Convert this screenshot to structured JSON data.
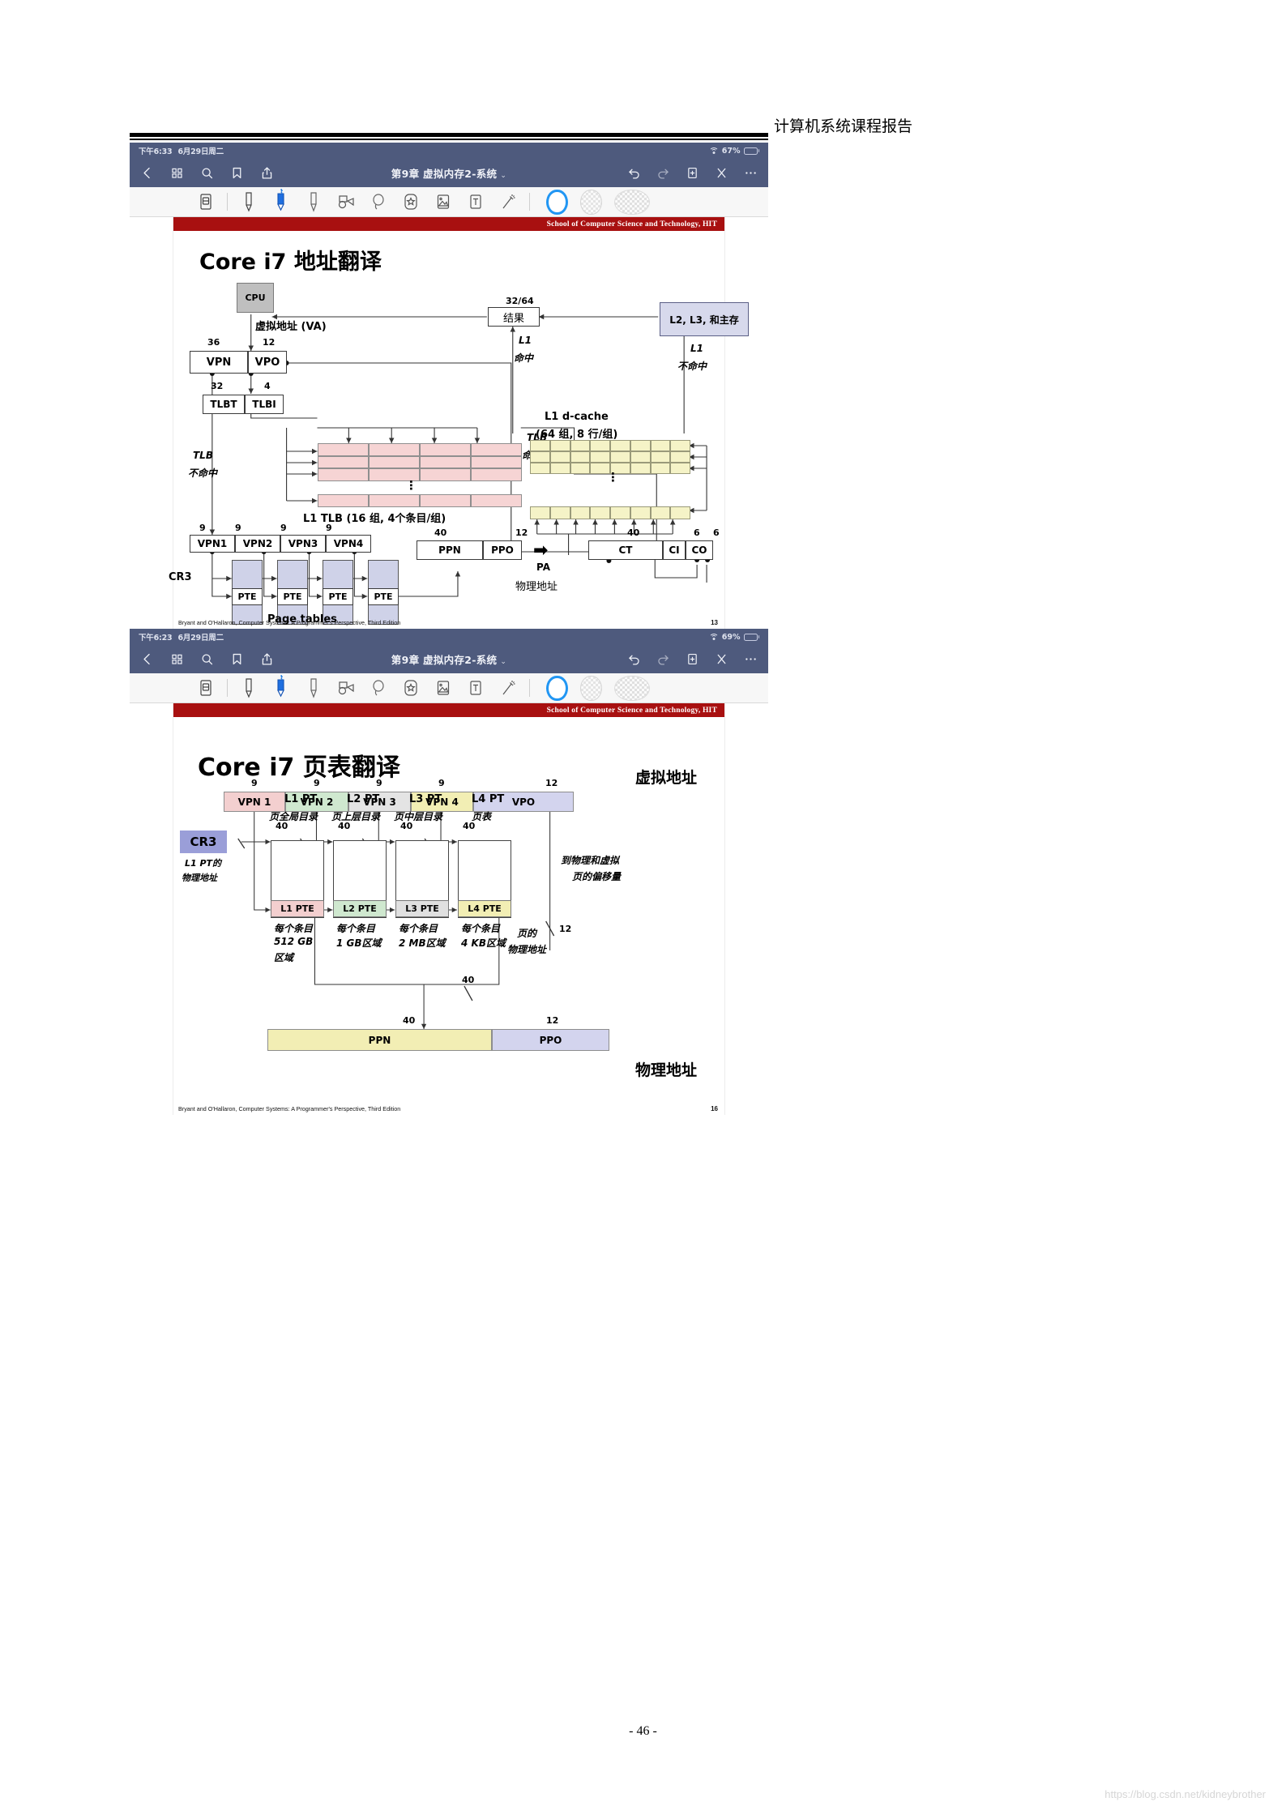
{
  "document": {
    "header_title": "计算机系统课程报告",
    "page_number": "- 46 -",
    "watermark": "https://blog.csdn.net/kidneybrother"
  },
  "screenshots": [
    {
      "status": {
        "time": "下午6:33",
        "date": "6月29日周二",
        "battery": "67%",
        "wifi_icon": "wifi-icon"
      },
      "nav": {
        "title": "第9章 虚拟内存2-系统",
        "chevron": "⌄",
        "left_icons": [
          "back-chevron-icon",
          "thumbnails-grid-icon",
          "search-icon",
          "bookmark-icon",
          "share-icon"
        ],
        "right_icons": [
          "undo-icon",
          "redo-icon",
          "add-page-icon",
          "close-icon",
          "more-icon"
        ]
      },
      "tools": {
        "items": [
          "eraser-icon",
          "pen-icon",
          "highlighter-icon",
          "pencil-icon",
          "shape-icon",
          "lasso-icon",
          "sticker-icon",
          "image-icon",
          "textbox-icon",
          "magic-wand-icon"
        ],
        "selected": "highlighter-icon",
        "swatches": [
          "active-color-swatch",
          "transparent-swatch-1",
          "transparent-swatch-2"
        ]
      },
      "slide": {
        "band": "School of Computer Science and Technology, HIT",
        "title": "Core i7 地址翻译",
        "footer": "Bryant and O'Hallaron, Computer Systems: A Programmer's Perspective, Third Edition",
        "number": "13",
        "nodes": {
          "cpu": "CPU",
          "va_label": "虚拟地址 (VA)",
          "result": "结果",
          "result_bits": "32/64",
          "mem": "L2, L3, 和主存",
          "l1_hit": [
            "L1",
            "命中"
          ],
          "l1_miss": [
            "L1",
            "不命中"
          ],
          "vpn": "VPN",
          "vpo": "VPO",
          "vpn_bits": "36",
          "vpo_bits": "12",
          "tlbt": "TLBT",
          "tlbi": "TLBI",
          "tlbt_bits": "32",
          "tlbi_bits": "4",
          "tlb_hit": [
            "TLB",
            "命中"
          ],
          "tlb_miss": [
            "TLB",
            "不命中"
          ],
          "tlb_caption": "L1 TLB (16 组, 4个条目/组)",
          "dcache_title": "L1 d-cache",
          "dcache_sub": "(64 组, 8 行/组)",
          "vpn_parts": [
            "VPN1",
            "VPN2",
            "VPN3",
            "VPN4"
          ],
          "vpn_part_bits": [
            "9",
            "9",
            "9",
            "9"
          ],
          "cr3": "CR3",
          "pte": [
            "PTE",
            "PTE",
            "PTE",
            "PTE"
          ],
          "page_tables": "Page tables",
          "ppn": "PPN",
          "ppo": "PPO",
          "ppn_bits": "40",
          "ppo_bits": "12",
          "pa": "PA",
          "pa_label": "物理地址",
          "ct": "CT",
          "ci": "CI",
          "co": "CO",
          "ct_bits": "40",
          "ci_bits": "6",
          "co_bits": "6"
        }
      }
    },
    {
      "status": {
        "time": "下午6:23",
        "date": "6月29日周二",
        "battery": "69%",
        "wifi_icon": "wifi-icon"
      },
      "nav": {
        "title": "第9章 虚拟内存2-系统",
        "chevron": "⌄",
        "left_icons": [
          "back-chevron-icon",
          "thumbnails-grid-icon",
          "search-icon",
          "bookmark-icon",
          "share-icon"
        ],
        "right_icons": [
          "undo-icon",
          "redo-icon",
          "add-page-icon",
          "close-icon",
          "more-icon"
        ]
      },
      "tools": {
        "items": [
          "eraser-icon",
          "pen-icon",
          "highlighter-icon",
          "pencil-icon",
          "shape-icon",
          "lasso-icon",
          "sticker-icon",
          "image-icon",
          "textbox-icon",
          "magic-wand-icon"
        ],
        "selected": "highlighter-icon",
        "swatches": [
          "active-color-swatch",
          "transparent-swatch-1",
          "transparent-swatch-2"
        ]
      },
      "slide": {
        "band": "School of Computer Science and Technology, HIT",
        "title": "Core i7 页表翻译",
        "footer": "Bryant and O'Hallaron, Computer Systems: A Programmer's Perspective, Third Edition",
        "number": "16",
        "nodes": {
          "va_label": "虚拟地址",
          "pa_label": "物理地址",
          "va_fields": [
            "VPN 1",
            "VPN 2",
            "VPN 3",
            "VPN 4",
            "VPO"
          ],
          "va_bits": [
            "9",
            "9",
            "9",
            "9",
            "12"
          ],
          "cr3": "CR3",
          "cr3_sub": [
            "L1 PT的",
            "物理地址"
          ],
          "pt_titles": [
            "L1 PT",
            "L2 PT",
            "L3 PT",
            "L4 PT"
          ],
          "pt_subtitles": [
            "页全局目录",
            "页上层目录",
            "页中层目录",
            "页表"
          ],
          "pte_labels": [
            "L1 PTE",
            "L2 PTE",
            "L3 PTE",
            "L4 PTE"
          ],
          "pt_bits": [
            "40",
            "40",
            "40",
            "40"
          ],
          "region_notes": [
            [
              "每个条目",
              "512 GB",
              "区域"
            ],
            [
              "每个条目",
              "1 GB区域"
            ],
            [
              "每个条目",
              "2 MB区域"
            ],
            [
              "每个条目",
              "4 KB区域"
            ]
          ],
          "offset_note": [
            "到物理和虚拟",
            "页的偏移量"
          ],
          "offset_bits": "12",
          "page_pa_note": [
            "页的",
            "物理地址"
          ],
          "ppn_arrow_bits": "40",
          "ppn": "PPN",
          "ppo": "PPO",
          "ppn_bits": "40",
          "ppo_bits": "12"
        }
      }
    }
  ],
  "colors": {
    "chrome": "#4e5a7d",
    "band": "#a81010",
    "accent": "#2196f3",
    "tlb_cell": "#f6d4d4",
    "cache_cell": "#f5f3c7",
    "mem_box": "#d7d9ec",
    "vpn1": "#f3cfcf",
    "vpn2": "#cfe8cf",
    "vpn3": "#e2e2e2",
    "vpn4": "#f2eeb4",
    "vpo": "#d3d4ee",
    "cr3": "#9a9ed8",
    "pte_box": "#cfd2e8"
  }
}
